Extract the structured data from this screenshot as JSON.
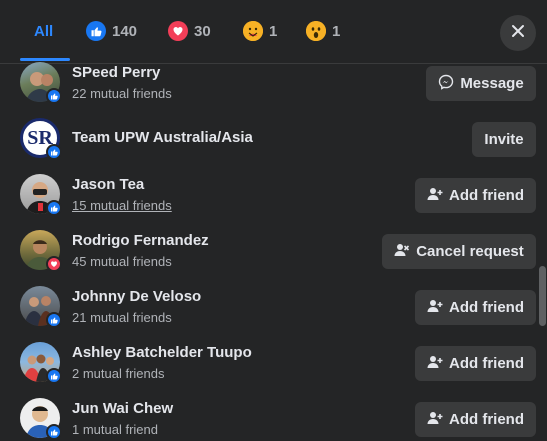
{
  "tabs": [
    {
      "label": "All",
      "icon": "none"
    },
    {
      "label": "140",
      "icon": "like-reaction-icon"
    },
    {
      "label": "30",
      "icon": "love-reaction-icon"
    },
    {
      "label": "1",
      "icon": "care-reaction-icon"
    },
    {
      "label": "1",
      "icon": "wow-reaction-icon"
    }
  ],
  "close_icon": "close-icon",
  "rows": [
    {
      "name": "SPeed Perry",
      "mutual": "22 mutual friends",
      "reaction": "like",
      "action": "Message",
      "action_icon": "messenger-icon"
    },
    {
      "name": "Team UPW Australia/Asia",
      "mutual": "",
      "reaction": "like",
      "action": "Invite",
      "action_icon": "",
      "avatar_text": "SR"
    },
    {
      "name": "Jason Tea",
      "mutual": "15 mutual friends",
      "reaction": "like",
      "action": "Add friend",
      "action_icon": "add-friend-icon"
    },
    {
      "name": "Rodrigo Fernandez",
      "mutual": "45 mutual friends",
      "reaction": "love",
      "action": "Cancel request",
      "action_icon": "cancel-request-icon"
    },
    {
      "name": "Johnny De Veloso",
      "mutual": "21 mutual friends",
      "reaction": "like",
      "action": "Add friend",
      "action_icon": "add-friend-icon"
    },
    {
      "name": "Ashley Batchelder Tuupo",
      "mutual": "2 mutual friends",
      "reaction": "like",
      "action": "Add friend",
      "action_icon": "add-friend-icon"
    },
    {
      "name": "Jun Wai Chew",
      "mutual": "1 mutual friend",
      "reaction": "like",
      "action": "Add friend",
      "action_icon": "add-friend-icon"
    }
  ],
  "colors": {
    "background": "#242526",
    "accent": "#2d88ff",
    "button": "#3a3b3c",
    "like": "#1877f2",
    "love": "#f33e58"
  }
}
